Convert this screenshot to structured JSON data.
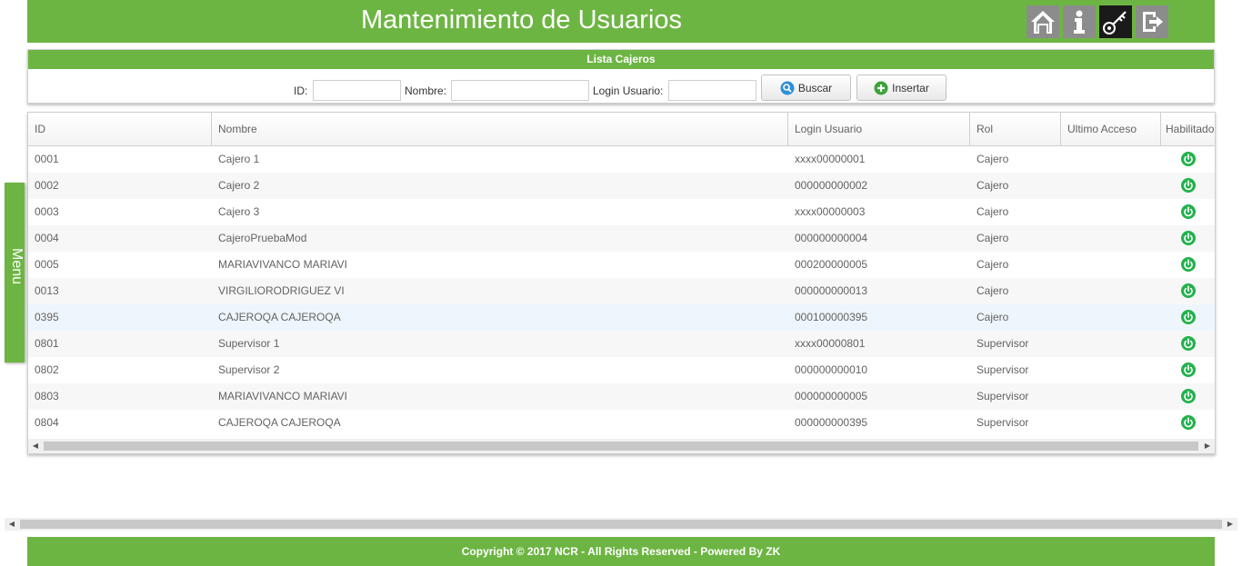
{
  "header": {
    "title": "Mantenimiento de Usuarios",
    "buttons": [
      "home-icon",
      "info-icon",
      "key-icon",
      "logout-icon"
    ],
    "accent": "#6db543"
  },
  "panel": {
    "caption": "Lista Cajeros",
    "id_label": "ID:",
    "id_value": "",
    "nombre_label": "Nombre:",
    "nombre_value": "",
    "login_label": "Login Usuario:",
    "login_value": "",
    "search_button": "Buscar",
    "insert_button": "Insertar"
  },
  "grid": {
    "columns": [
      "ID",
      "Nombre",
      "Login Usuario",
      "Rol",
      "Ultimo Acceso",
      "Habilitado"
    ],
    "rows": [
      {
        "id": "0001",
        "nombre": "Cajero 1",
        "login": "xxxx00000001",
        "rol": "Cajero",
        "ultimo": "",
        "habilitado": "power-icon"
      },
      {
        "id": "0002",
        "nombre": "Cajero 2",
        "login": "000000000002",
        "rol": "Cajero",
        "ultimo": "",
        "habilitado": "power-icon"
      },
      {
        "id": "0003",
        "nombre": "Cajero 3",
        "login": "xxxx00000003",
        "rol": "Cajero",
        "ultimo": "",
        "habilitado": "power-icon"
      },
      {
        "id": "0004",
        "nombre": "CajeroPruebaMod",
        "login": "000000000004",
        "rol": "Cajero",
        "ultimo": "",
        "habilitado": "power-icon"
      },
      {
        "id": "0005",
        "nombre": "MARIAVIVANCO MARIAVI",
        "login": "000200000005",
        "rol": "Cajero",
        "ultimo": "",
        "habilitado": "power-icon"
      },
      {
        "id": "0013",
        "nombre": "VIRGILIORODRIGUEZ VI",
        "login": "000000000013",
        "rol": "Cajero",
        "ultimo": "",
        "habilitado": "power-icon"
      },
      {
        "id": "0395",
        "nombre": "CAJEROQA CAJEROQA",
        "login": "000100000395",
        "rol": "Cajero",
        "ultimo": "",
        "habilitado": "power-icon"
      },
      {
        "id": "0801",
        "nombre": "Supervisor 1",
        "login": "xxxx00000801",
        "rol": "Supervisor",
        "ultimo": "",
        "habilitado": "power-icon"
      },
      {
        "id": "0802",
        "nombre": "Supervisor 2",
        "login": "000000000010",
        "rol": "Supervisor",
        "ultimo": "",
        "habilitado": "power-icon"
      },
      {
        "id": "0803",
        "nombre": "MARIAVIVANCO MARIAVI",
        "login": "000000000005",
        "rol": "Supervisor",
        "ultimo": "",
        "habilitado": "power-icon"
      },
      {
        "id": "0804",
        "nombre": "CAJEROQA CAJEROQA",
        "login": "000000000395",
        "rol": "Supervisor",
        "ultimo": "",
        "habilitado": "power-icon"
      }
    ],
    "highlighted_row": 6
  },
  "side_menu": {
    "label": "Menu"
  },
  "footer": {
    "text": "Copyright © 2017 NCR - All Rights Reserved - Powered By ZK"
  }
}
